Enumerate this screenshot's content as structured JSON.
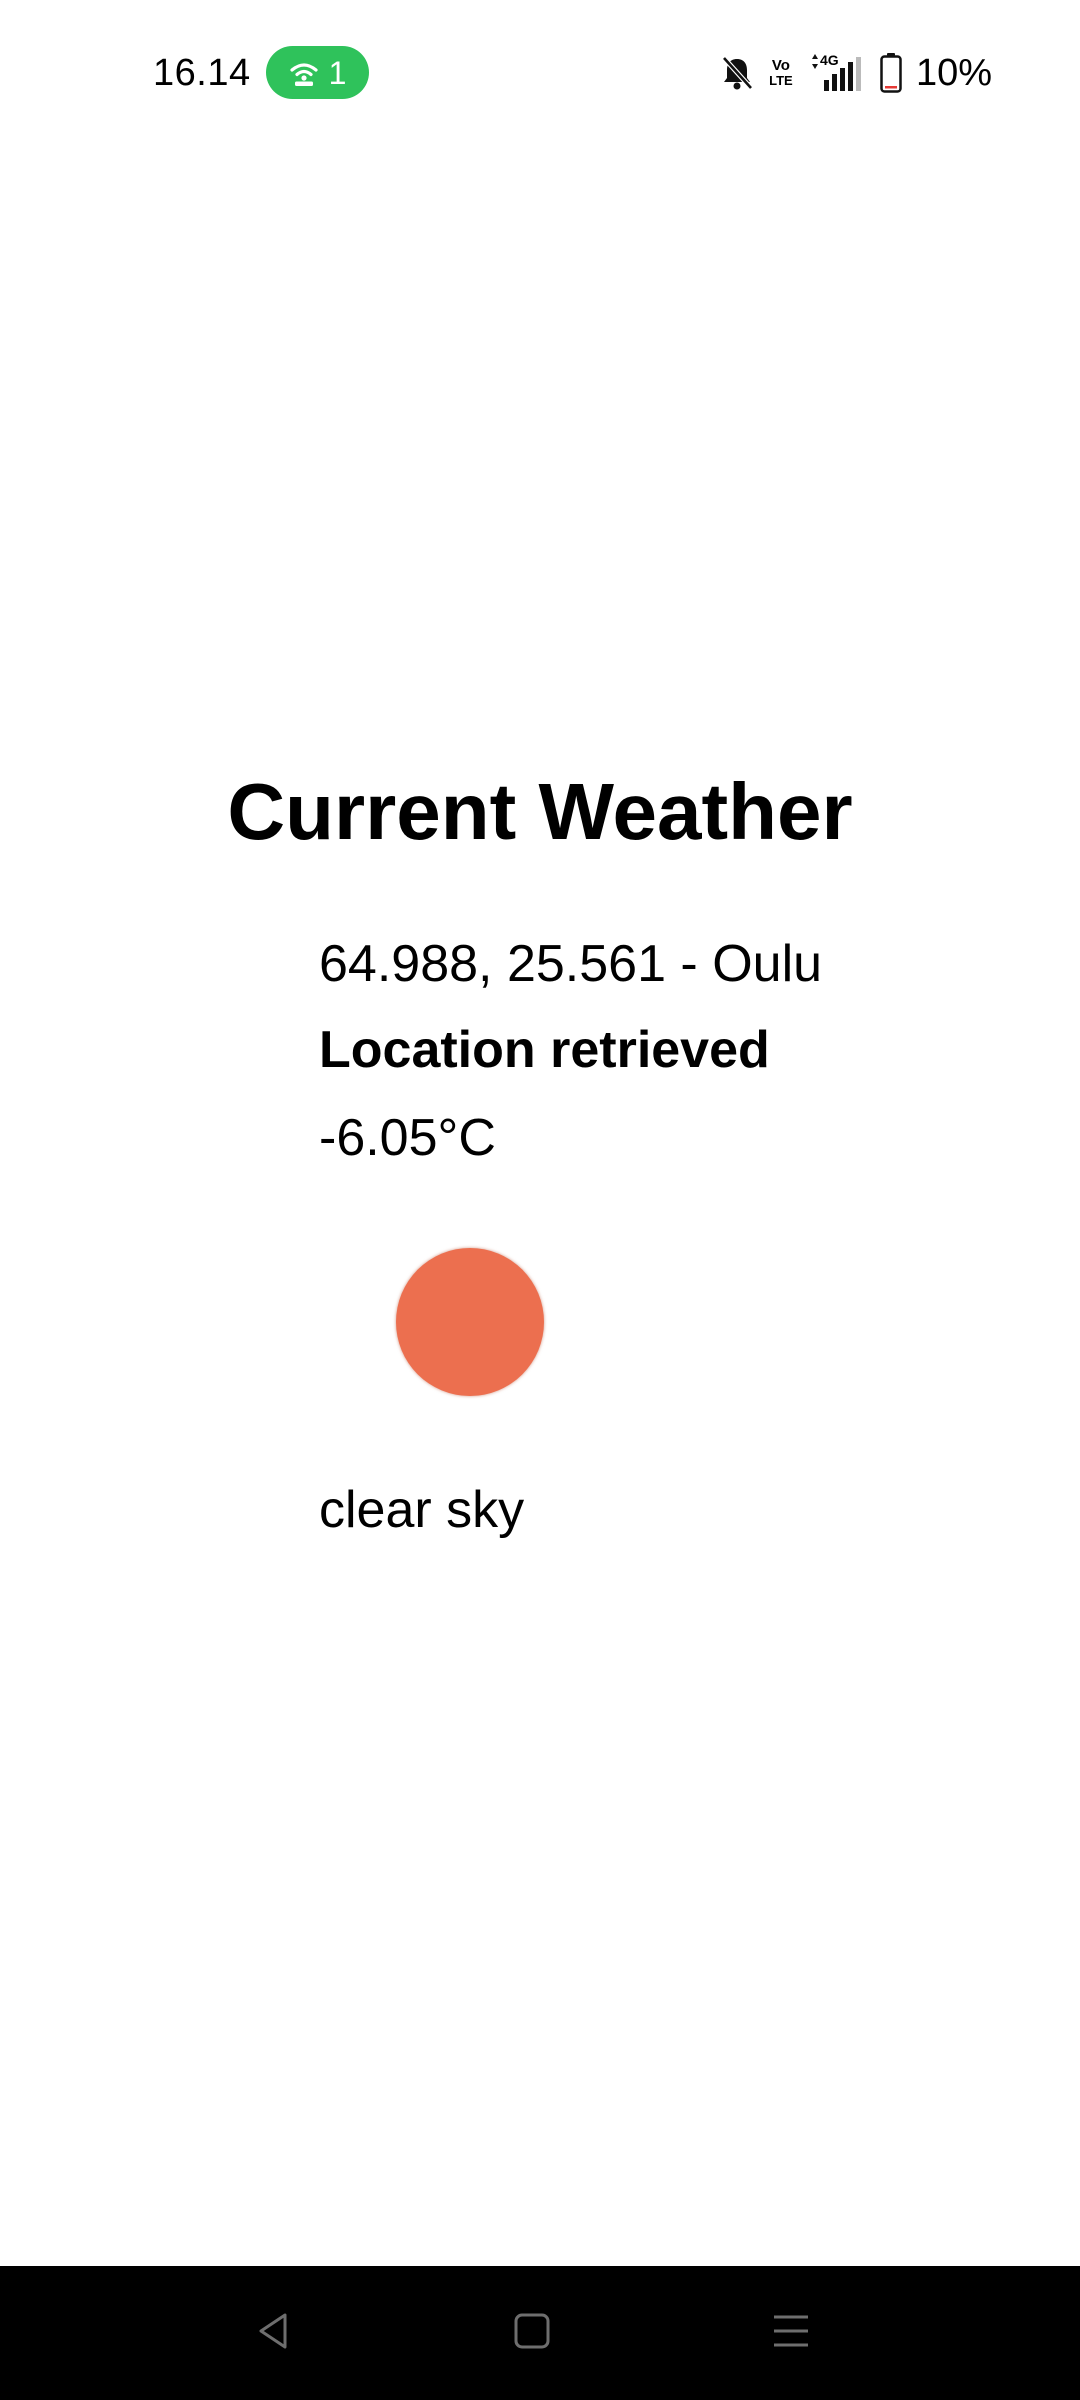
{
  "status_bar": {
    "time": "16.14",
    "hotspot_count": "1",
    "volte_top": "Vo",
    "volte_bottom": "LTE",
    "network": "4G",
    "battery": "10%",
    "hotspot_color": "#2fc25b"
  },
  "icons": {
    "hotspot": "wifi-hotspot-icon",
    "mute": "bell-off-icon",
    "signal": "signal-icon",
    "battery": "battery-icon",
    "back": "back-triangle-icon",
    "home": "home-square-icon",
    "menu": "menu-lines-icon"
  },
  "weather": {
    "title": "Current Weather",
    "coordinates": "64.988, 25.561 - Oulu",
    "location_status": "Location retrieved",
    "temperature": "-6.05°C",
    "description": "clear sky",
    "icon_color": "#ec6f4f"
  }
}
